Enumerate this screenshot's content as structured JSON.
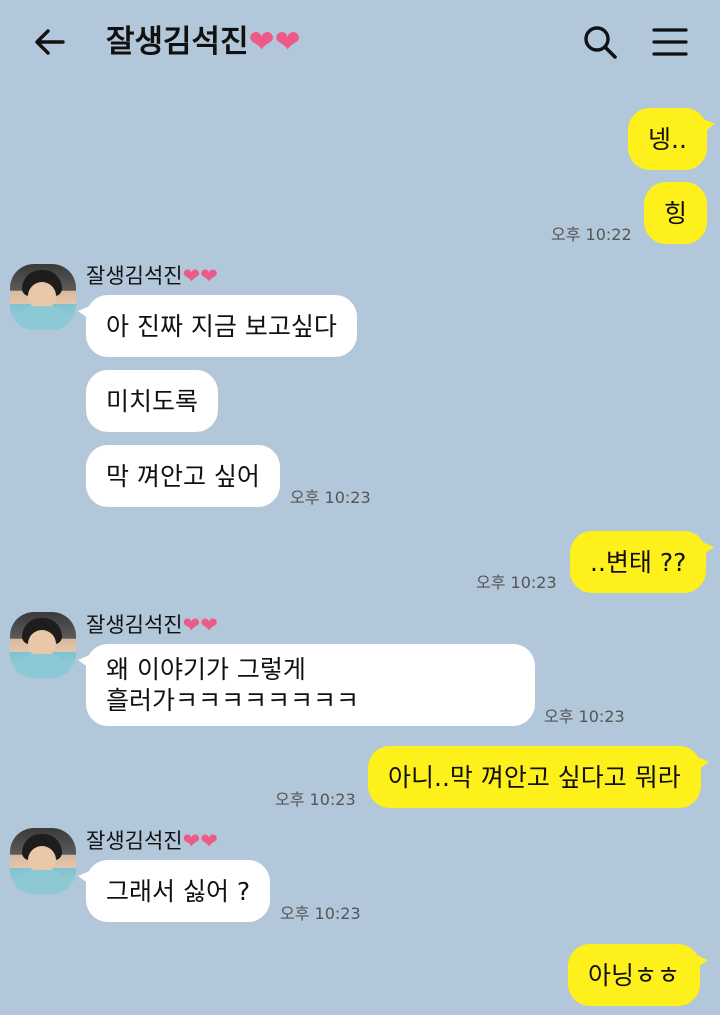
{
  "header": {
    "title": "잘생김석진",
    "hearts": "❤❤"
  },
  "icons": {
    "back": "arrow-left-icon",
    "search": "search-icon",
    "menu": "hamburger-menu-icon"
  },
  "colors": {
    "background": "#b2c7d9",
    "my_bubble": "#fef01b",
    "other_bubble": "#ffffff",
    "heart": "#ec5b87"
  },
  "messages": {
    "m1": "넹..",
    "m2": "힝",
    "t1": "오후 10:22",
    "sender1": "잘생김석진",
    "m3": "아 진짜 지금 보고싶다",
    "m4": "미치도록",
    "m5": "막 껴안고 싶어",
    "t2": "오후 10:23",
    "m6": "..변태 ??",
    "t3": "오후 10:23",
    "sender2": "잘생김석진",
    "m7_line1": "왜 이야기가 그렇게",
    "m7_line2": "흘러가ㅋㅋㅋㅋㅋㅋㅋㅋ",
    "t4": "오후 10:23",
    "m8": "아니..막 껴안고 싶다고 뭐라",
    "t5": "오후 10:23",
    "sender3": "잘생김석진",
    "m9": "그래서 싫어 ?",
    "t6": "오후 10:23",
    "m10": "아닝ㅎㅎ"
  }
}
